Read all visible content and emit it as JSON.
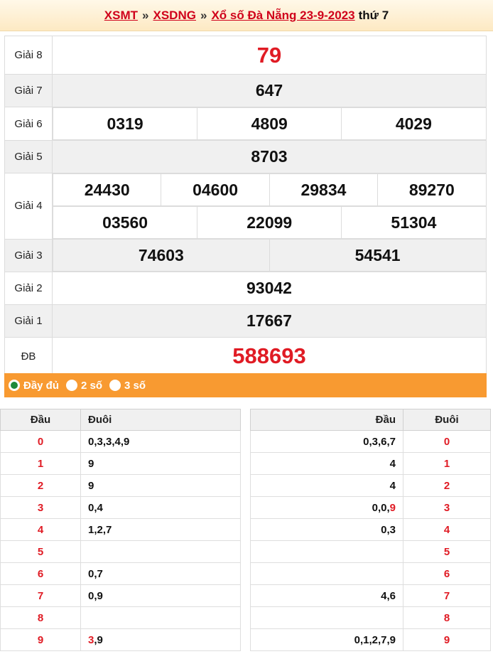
{
  "header": {
    "link1": "XSMT",
    "sep1": "»",
    "link2": "XSDNG",
    "sep2": "»",
    "link3": "Xổ số Đà Nẵng 23-9-2023",
    "tail": "thứ 7"
  },
  "results": {
    "g8": {
      "label": "Giải 8",
      "values": [
        "79"
      ]
    },
    "g7": {
      "label": "Giải 7",
      "values": [
        "647"
      ]
    },
    "g6": {
      "label": "Giải 6",
      "values": [
        "0319",
        "4809",
        "4029"
      ]
    },
    "g5": {
      "label": "Giải 5",
      "values": [
        "8703"
      ]
    },
    "g4": {
      "label": "Giải 4",
      "values": [
        "24430",
        "04600",
        "29834",
        "89270",
        "03560",
        "22099",
        "51304"
      ]
    },
    "g3": {
      "label": "Giải 3",
      "values": [
        "74603",
        "54541"
      ]
    },
    "g2": {
      "label": "Giải 2",
      "values": [
        "93042"
      ]
    },
    "g1": {
      "label": "Giải 1",
      "values": [
        "17667"
      ]
    },
    "db": {
      "label": "ĐB",
      "values": [
        "588693"
      ]
    }
  },
  "options": {
    "full": "Đầy đủ",
    "two": "2 số",
    "three": "3 số",
    "selected": "full"
  },
  "dau_table": {
    "head_label": "Đầu",
    "tail_label": "Đuôi",
    "rows": [
      {
        "key": "0",
        "val": "0,3,3,4,9"
      },
      {
        "key": "1",
        "val": "9"
      },
      {
        "key": "2",
        "val": "9"
      },
      {
        "key": "3",
        "val": "0,4"
      },
      {
        "key": "4",
        "val": "1,2,7"
      },
      {
        "key": "5",
        "val": ""
      },
      {
        "key": "6",
        "val": "0,7"
      },
      {
        "key": "7",
        "val": "0,9"
      },
      {
        "key": "8",
        "val": ""
      },
      {
        "key": "9",
        "val_hl": "3",
        "val_rest": ",9"
      }
    ]
  },
  "duoi_table": {
    "head_label": "Đầu",
    "tail_label": "Đuôi",
    "rows": [
      {
        "key": "0",
        "val": "0,3,6,7"
      },
      {
        "key": "1",
        "val": "4"
      },
      {
        "key": "2",
        "val": "4"
      },
      {
        "key": "3",
        "val_rest": "0,0,",
        "val_hl": "9"
      },
      {
        "key": "4",
        "val": "0,3"
      },
      {
        "key": "5",
        "val": ""
      },
      {
        "key": "6",
        "val": ""
      },
      {
        "key": "7",
        "val": "4,6"
      },
      {
        "key": "8",
        "val": ""
      },
      {
        "key": "9",
        "val": "0,1,2,7,9"
      }
    ]
  },
  "colors": {
    "accent_red": "#e01b24",
    "option_bar": "#f89a31",
    "radio_selected": "#1f8a3a"
  }
}
